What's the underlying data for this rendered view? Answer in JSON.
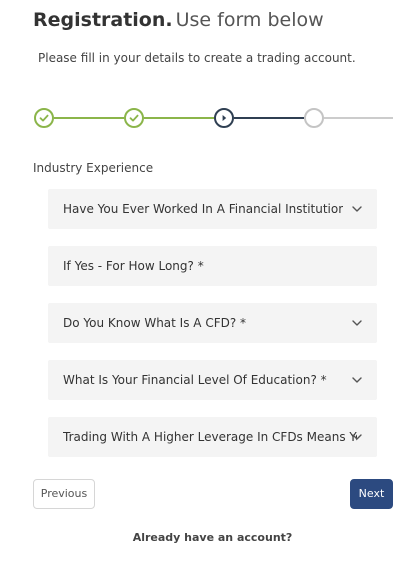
{
  "header": {
    "title_bold": "Registration.",
    "title_light": "Use form below",
    "intro": "Please fill in your details to create a trading account."
  },
  "stepper": {
    "total_steps": 4,
    "current_step": 3,
    "completed_steps": 2,
    "colors": {
      "completed": "#8bb54a",
      "current": "#2f3f52",
      "pending": "#c4c4c4"
    }
  },
  "section": {
    "label": "Industry Experience"
  },
  "fields": [
    {
      "label": "Have You Ever Worked In A Financial Institution? *",
      "type": "select"
    },
    {
      "label": "If Yes - For How Long?  *",
      "type": "input"
    },
    {
      "label": "Do You Know What Is A CFD? *",
      "type": "select"
    },
    {
      "label": "What Is Your Financial Level Of Education? *",
      "type": "select"
    },
    {
      "label": "Trading With A Higher Leverage In CFDs Means You May Lose More",
      "type": "select"
    }
  ],
  "buttons": {
    "previous": "Previous",
    "next": "Next"
  },
  "footer": {
    "already": "Already have an account?"
  },
  "colors": {
    "primary": "#2c4a80",
    "field_bg": "#f4f4f4"
  }
}
